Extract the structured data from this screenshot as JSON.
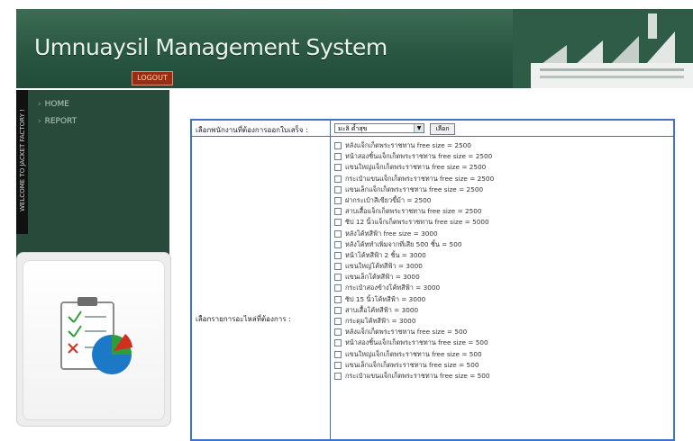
{
  "header": {
    "title": "Umnuaysil Management System",
    "logout_label": "LOGOUT"
  },
  "sidebar": {
    "vertical_text": "WELCOME TO JACKET FACTORY !",
    "items": [
      {
        "label": "HOME"
      },
      {
        "label": "REPORT"
      }
    ]
  },
  "form": {
    "employee_label": "เลือกพนักงานที่ต้องการออกใบเสร็จ :",
    "employee_selected": "มะลิ ด้ำสุข",
    "choose_button": "เลือก",
    "items_label": "เลือกรายการอะไหล่ที่ต้องการ :",
    "items": [
      "หลังแจ็กเก็ตพระราชทาน free size = 2500",
      "หน้าสองชิ้นแจ็กเก็ตพระราชทาน free size = 2500",
      "แขนใหญ่แจ็กเก็ตพระราชทาน free size = 2500",
      "กระเป๋าแขนแจ็กเก็ตพระราชทาน free size = 2500",
      "แขนเล็กแจ็กเก็ตพระราชทาน free size = 2500",
      "ฝากระเป๋าสีเขียวขี้ม้า = 2500",
      "สาบเสื้อแจ็กเก็ตพระราชทาน free size = 2500",
      "ซิป 12 นิ้วแจ็กเก็ตพระราชทาน free size = 5000",
      "หลังโค้ทสีฟ้า free size = 3000",
      "หลังโค้ททำเพิ่มจากที่เสีย 500 ชิ้น = 500",
      "หน้าโค้ทสีฟ้า 2 ชิ้น = 3000",
      "แขนใหญ่โค้ทสีฟ้า = 3000",
      "แขนเล็กโค้ทสีฟ้า = 3000",
      "กระเป๋าสองข้างโค้ทสีฟ้า = 3000",
      "ซิป 15 นิ้วโค้ทสีฟ้า = 3000",
      "สาบเสื้อโค้ทสีฟ้า = 3000",
      "กระดุมโค้ทสีฟ้า = 3000",
      "หลังแจ็กเก็ตพระราชทาน free size = 500",
      "หน้าสองชิ้นแจ็กเก็ตพระราชทาน free size = 500",
      "แขนใหญ่แจ็กเก็ตพระราชทาน free size = 500",
      "แขนเล็กแจ็กเก็ตพระราชทาน free size = 500",
      "กระเป๋าแขนแจ็กเก็ตพระราชทาน free size = 500"
    ]
  }
}
